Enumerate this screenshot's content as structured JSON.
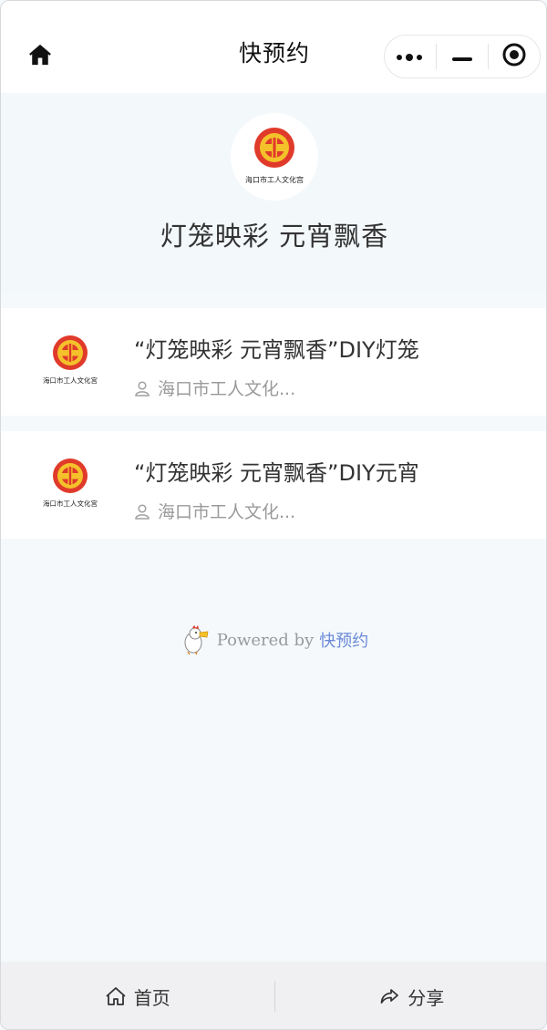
{
  "navbar": {
    "title": "快预约",
    "home_icon": "home-icon",
    "menu_icon": "more-dots-icon",
    "minimize_icon": "minimize-icon",
    "close_icon": "target-close-icon"
  },
  "org": {
    "name": "灯笼映彩 元宵飘香",
    "logo_text": "海口市工人文化宫"
  },
  "activities": [
    {
      "title": "“灯笼映彩 元宵飘香”DIY灯笼",
      "org": "海口市工人文化...",
      "logo_text": "海口市工人文化宫"
    },
    {
      "title": "“灯笼映彩 元宵飘香”DIY元宵",
      "org": "海口市工人文化...",
      "logo_text": "海口市工人文化宫"
    }
  ],
  "footer": {
    "powered_prefix": "Powered by",
    "brand": "快预约"
  },
  "tabbar": {
    "home_label": "首页",
    "share_label": "分享"
  },
  "colors": {
    "accent_red": "#e03a2b",
    "logo_yellow": "#f4c12a",
    "brand_blue": "#6b8ad8",
    "page_bg": "#f5f9fc"
  }
}
